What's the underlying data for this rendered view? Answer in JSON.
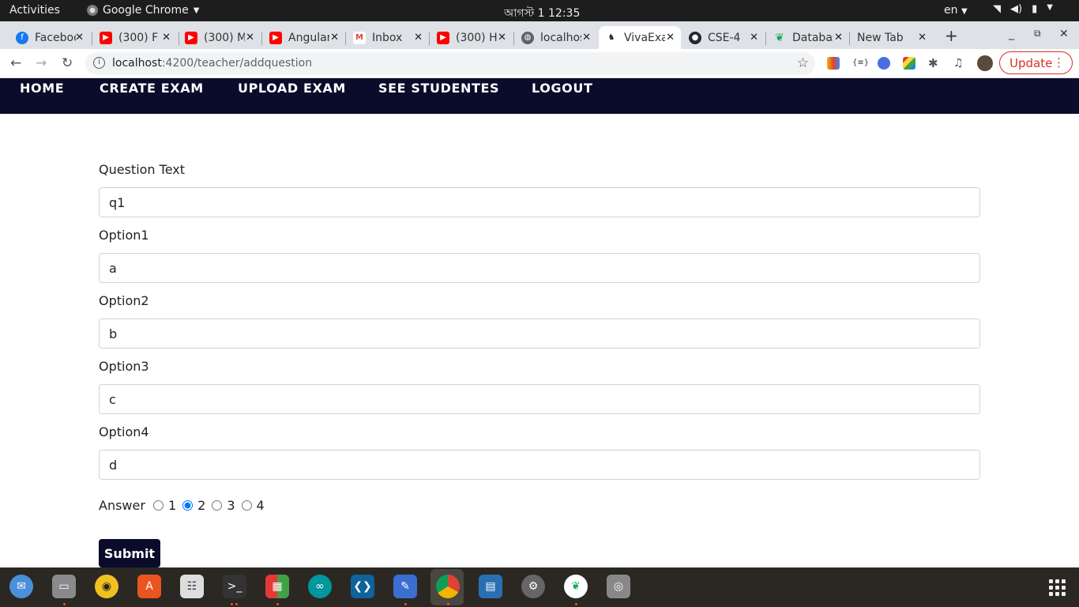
{
  "topbar": {
    "activities": "Activities",
    "app_name": "Google Chrome",
    "clock": "আগস্ট 1  12:35",
    "lang": "en"
  },
  "tabs": [
    {
      "title": "Facebook",
      "favicon": "facebook-icon",
      "color": "#1877f2"
    },
    {
      "title": "(300) F",
      "favicon": "youtube-icon",
      "color": "#ff0000"
    },
    {
      "title": "(300) M",
      "favicon": "youtube-icon",
      "color": "#ff0000"
    },
    {
      "title": "Angular",
      "favicon": "youtube-icon",
      "color": "#ff0000"
    },
    {
      "title": "Inbox",
      "favicon": "gmail-icon",
      "color": "#ea4335"
    },
    {
      "title": "(300) H",
      "favicon": "youtube-icon",
      "color": "#ff0000"
    },
    {
      "title": "localhost",
      "favicon": "globe-icon",
      "color": "#5f6368"
    },
    {
      "title": "VivaExam",
      "favicon": "app-icon",
      "color": "#222222"
    },
    {
      "title": "CSE-4",
      "favicon": "github-icon",
      "color": "#24292e"
    },
    {
      "title": "Database",
      "favicon": "mongodb-icon",
      "color": "#13aa52"
    },
    {
      "title": "New Tab",
      "favicon": "",
      "color": ""
    }
  ],
  "address_bar": {
    "host": "localhost",
    "path": ":4200/teacher/addquestion",
    "update_label": "Update"
  },
  "nav": {
    "home": "HOME",
    "create_exam": "CREATE EXAM",
    "upload_exam": "UPLOAD EXAM",
    "see_students": "SEE STUDENTES",
    "logout": "LOGOUT"
  },
  "form": {
    "question_label": "Question Text",
    "question_value": "q1",
    "option1_label": "Option1",
    "option1_value": "a",
    "option2_label": "Option2",
    "option2_value": "b",
    "option3_label": "Option3",
    "option3_value": "c",
    "option4_label": "Option4",
    "option4_value": "d",
    "answer_label": "Answer",
    "answer_options": [
      "1",
      "2",
      "3",
      "4"
    ],
    "selected_answer": "2",
    "submit_label": "Submit"
  },
  "colors": {
    "nav_bg": "#0b0b2b",
    "update_red": "#d93025",
    "radio_accent": "#3b1ee0"
  }
}
